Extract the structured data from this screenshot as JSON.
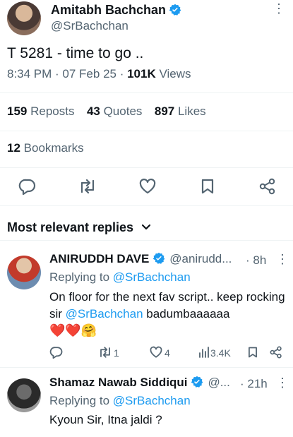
{
  "tweet": {
    "author_name": "Amitabh Bachchan",
    "author_handle": "@SrBachchan",
    "text": "T 5281 - time to go ..",
    "time": "8:34 PM · 07 Feb 25 · ",
    "views_count": "101K",
    "views_label": " Views",
    "reposts_count": "159",
    "reposts_label": " Reposts",
    "quotes_count": "43",
    "quotes_label": " Quotes",
    "likes_count": "897",
    "likes_label": " Likes",
    "bookmarks_count": "12",
    "bookmarks_label": " Bookmarks"
  },
  "replies_header": "Most relevant replies",
  "replies": [
    {
      "name": "ANIRUDDH DAVE",
      "handle": "@anirudd...",
      "time": "· 8h",
      "replying_prefix": "Replying to ",
      "replying_to": "@SrBachchan",
      "text_1": "On floor for the next fav script.. keep rocking sir ",
      "mention": "@SrBachchan",
      "text_2": " badumbaaaaaa",
      "emoji": "❤️❤️🤗",
      "replies_count": "",
      "reposts_count": "1",
      "likes_count": "4",
      "views_count": "3.4K"
    },
    {
      "name": "Shamaz Nawab Siddiqui",
      "handle": "@...",
      "time": "· 21h",
      "replying_prefix": "Replying to ",
      "replying_to": "@SrBachchan",
      "text": "Kyoun Sir, Itna jaldi ?"
    }
  ],
  "colors": {
    "accent": "#1d9bf0",
    "text": "#0f1419",
    "secondary": "#536471",
    "heart": "#e0245e"
  }
}
